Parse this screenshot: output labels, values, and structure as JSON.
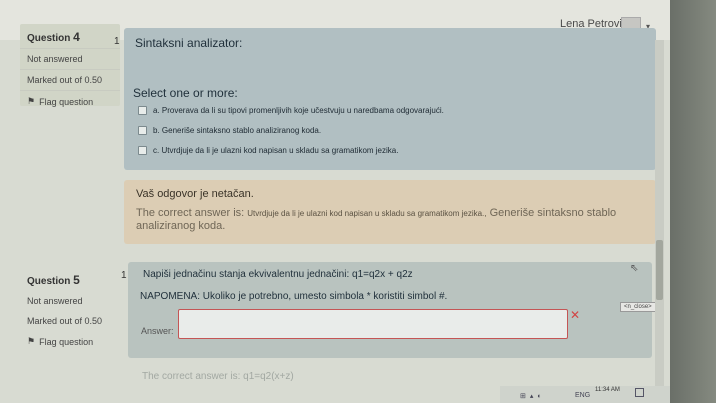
{
  "header": {
    "user_name": "Lena Petrovic"
  },
  "q4": {
    "info": {
      "prefix": "Question",
      "number": "4",
      "status": "Not answered",
      "marks": "Marked out of 0.50",
      "flag": "Flag question"
    },
    "num": "1",
    "text": "Sintaksni analizator:",
    "prompt": "Select one or more:",
    "options": [
      "a. Proverava da li su tipovi promenljivih koje učestvuju u naredbama odgovarajući.",
      "b. Generiše sintaksno stablo analiziranog koda.",
      "c. Utvrdjuje da li je ulazni kod napisan u skladu sa gramatikom jezika."
    ],
    "feedback": {
      "wrong": "Vaš odgovor je netačan.",
      "correct_prefix": "The correct answer is:",
      "correct_small": "Utvrdjuje da li je ulazni kod napisan u skladu sa gramatikom jezika.,",
      "correct_rest": "Generiše sintaksno stablo analiziranog koda."
    }
  },
  "q5": {
    "info": {
      "prefix": "Question",
      "number": "5",
      "status": "Not answered",
      "marks": "Marked out of 0.50",
      "flag": "Flag question"
    },
    "num": "1",
    "text": "Napiši jednačinu stanja ekvivalentnu jednačini: q1=q2x + q2z",
    "note": "NAPOMENA: Ukoliko je potrebno, umesto simbola * koristiti simbol #.",
    "answer_label": "Answer:",
    "answer_value": "",
    "close_tag": "<n_close>",
    "feedback": "The correct answer is: q1=q2(x+z)"
  },
  "taskbar": {
    "lang": "ENG",
    "time": "11:34 AM"
  }
}
